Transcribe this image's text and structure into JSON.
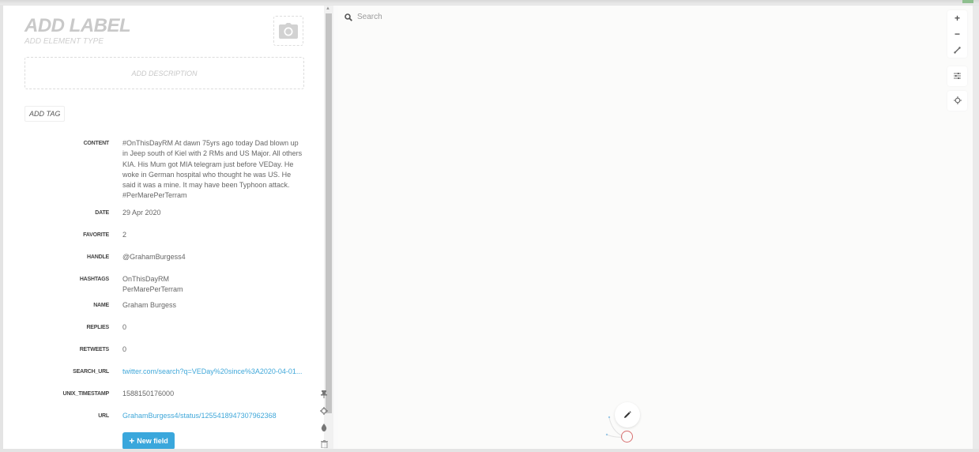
{
  "panel": {
    "label_placeholder": "ADD LABEL",
    "element_type_placeholder": "ADD ELEMENT TYPE",
    "description_placeholder": "ADD DESCRIPTION",
    "add_tag_label": "ADD TAG",
    "photo_icon": "camera-icon",
    "fields": [
      {
        "key": "CONTENT",
        "value": "#OnThisDayRM At dawn 75yrs ago today Dad blown up in Jeep south of Kiel with 2 RMs and US Major. All others KIA. His Mum got MIA telegram just before VEDay. He woke in German hospital who thought he was US. He said it was a mine. It may have been Typhoon attack. #PerMarePerTerram"
      },
      {
        "key": "DATE",
        "value": "29 Apr 2020"
      },
      {
        "key": "FAVORITE",
        "value": "2"
      },
      {
        "key": "HANDLE",
        "value": "@GrahamBurgess4"
      },
      {
        "key": "HASHTAGS",
        "value": "OnThisDayRM\nPerMarePerTerram"
      },
      {
        "key": "NAME",
        "value": "Graham Burgess"
      },
      {
        "key": "REPLIES",
        "value": "0"
      },
      {
        "key": "RETWEETS",
        "value": "0"
      },
      {
        "key": "SEARCH_URL",
        "value": "twitter.com/search?q=VEDay%20since%3A2020-04-01...",
        "link": true
      },
      {
        "key": "UNIX_TIMESTAMP",
        "value": "1588150176000"
      },
      {
        "key": "URL",
        "value": "GrahamBurgess4/status/1255418947307962368",
        "link": true
      }
    ],
    "new_field_label": "New field",
    "side_icons": [
      "pin-icon",
      "focus-icon",
      "color-drop-icon",
      "trash-icon"
    ]
  },
  "canvas": {
    "search_placeholder": "Search",
    "controls": [
      "zoom-in-icon",
      "zoom-out-icon",
      "fit-line-icon",
      "settings-sliders-icon",
      "center-focus-icon"
    ]
  },
  "colors": {
    "accent": "#3aa7dc",
    "link": "#3fa7d9",
    "selection_ring": "#d87070"
  }
}
